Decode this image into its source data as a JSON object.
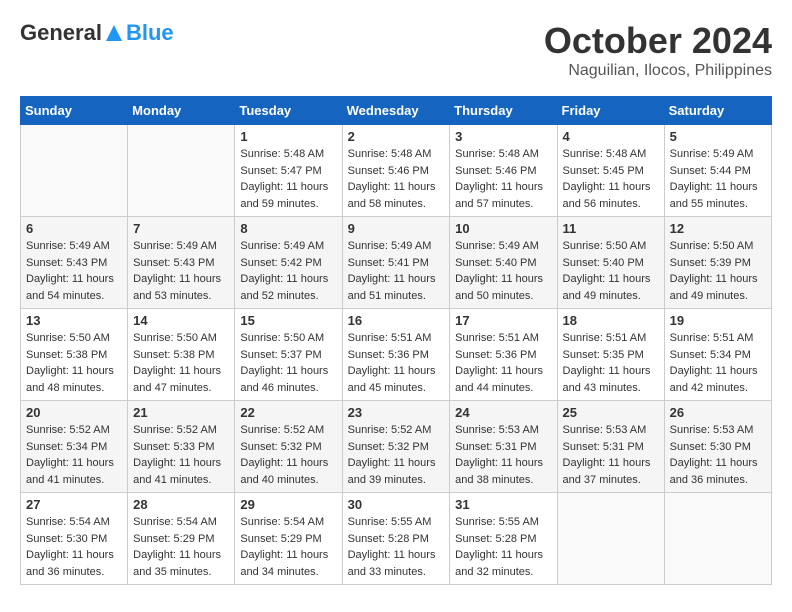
{
  "header": {
    "logo_general": "General",
    "logo_blue": "Blue",
    "month": "October 2024",
    "location": "Naguilian, Ilocos, Philippines"
  },
  "weekdays": [
    "Sunday",
    "Monday",
    "Tuesday",
    "Wednesday",
    "Thursday",
    "Friday",
    "Saturday"
  ],
  "weeks": [
    [
      {
        "day": "",
        "info": ""
      },
      {
        "day": "",
        "info": ""
      },
      {
        "day": "1",
        "info": "Sunrise: 5:48 AM\nSunset: 5:47 PM\nDaylight: 11 hours and 59 minutes."
      },
      {
        "day": "2",
        "info": "Sunrise: 5:48 AM\nSunset: 5:46 PM\nDaylight: 11 hours and 58 minutes."
      },
      {
        "day": "3",
        "info": "Sunrise: 5:48 AM\nSunset: 5:46 PM\nDaylight: 11 hours and 57 minutes."
      },
      {
        "day": "4",
        "info": "Sunrise: 5:48 AM\nSunset: 5:45 PM\nDaylight: 11 hours and 56 minutes."
      },
      {
        "day": "5",
        "info": "Sunrise: 5:49 AM\nSunset: 5:44 PM\nDaylight: 11 hours and 55 minutes."
      }
    ],
    [
      {
        "day": "6",
        "info": "Sunrise: 5:49 AM\nSunset: 5:43 PM\nDaylight: 11 hours and 54 minutes."
      },
      {
        "day": "7",
        "info": "Sunrise: 5:49 AM\nSunset: 5:43 PM\nDaylight: 11 hours and 53 minutes."
      },
      {
        "day": "8",
        "info": "Sunrise: 5:49 AM\nSunset: 5:42 PM\nDaylight: 11 hours and 52 minutes."
      },
      {
        "day": "9",
        "info": "Sunrise: 5:49 AM\nSunset: 5:41 PM\nDaylight: 11 hours and 51 minutes."
      },
      {
        "day": "10",
        "info": "Sunrise: 5:49 AM\nSunset: 5:40 PM\nDaylight: 11 hours and 50 minutes."
      },
      {
        "day": "11",
        "info": "Sunrise: 5:50 AM\nSunset: 5:40 PM\nDaylight: 11 hours and 49 minutes."
      },
      {
        "day": "12",
        "info": "Sunrise: 5:50 AM\nSunset: 5:39 PM\nDaylight: 11 hours and 49 minutes."
      }
    ],
    [
      {
        "day": "13",
        "info": "Sunrise: 5:50 AM\nSunset: 5:38 PM\nDaylight: 11 hours and 48 minutes."
      },
      {
        "day": "14",
        "info": "Sunrise: 5:50 AM\nSunset: 5:38 PM\nDaylight: 11 hours and 47 minutes."
      },
      {
        "day": "15",
        "info": "Sunrise: 5:50 AM\nSunset: 5:37 PM\nDaylight: 11 hours and 46 minutes."
      },
      {
        "day": "16",
        "info": "Sunrise: 5:51 AM\nSunset: 5:36 PM\nDaylight: 11 hours and 45 minutes."
      },
      {
        "day": "17",
        "info": "Sunrise: 5:51 AM\nSunset: 5:36 PM\nDaylight: 11 hours and 44 minutes."
      },
      {
        "day": "18",
        "info": "Sunrise: 5:51 AM\nSunset: 5:35 PM\nDaylight: 11 hours and 43 minutes."
      },
      {
        "day": "19",
        "info": "Sunrise: 5:51 AM\nSunset: 5:34 PM\nDaylight: 11 hours and 42 minutes."
      }
    ],
    [
      {
        "day": "20",
        "info": "Sunrise: 5:52 AM\nSunset: 5:34 PM\nDaylight: 11 hours and 41 minutes."
      },
      {
        "day": "21",
        "info": "Sunrise: 5:52 AM\nSunset: 5:33 PM\nDaylight: 11 hours and 41 minutes."
      },
      {
        "day": "22",
        "info": "Sunrise: 5:52 AM\nSunset: 5:32 PM\nDaylight: 11 hours and 40 minutes."
      },
      {
        "day": "23",
        "info": "Sunrise: 5:52 AM\nSunset: 5:32 PM\nDaylight: 11 hours and 39 minutes."
      },
      {
        "day": "24",
        "info": "Sunrise: 5:53 AM\nSunset: 5:31 PM\nDaylight: 11 hours and 38 minutes."
      },
      {
        "day": "25",
        "info": "Sunrise: 5:53 AM\nSunset: 5:31 PM\nDaylight: 11 hours and 37 minutes."
      },
      {
        "day": "26",
        "info": "Sunrise: 5:53 AM\nSunset: 5:30 PM\nDaylight: 11 hours and 36 minutes."
      }
    ],
    [
      {
        "day": "27",
        "info": "Sunrise: 5:54 AM\nSunset: 5:30 PM\nDaylight: 11 hours and 36 minutes."
      },
      {
        "day": "28",
        "info": "Sunrise: 5:54 AM\nSunset: 5:29 PM\nDaylight: 11 hours and 35 minutes."
      },
      {
        "day": "29",
        "info": "Sunrise: 5:54 AM\nSunset: 5:29 PM\nDaylight: 11 hours and 34 minutes."
      },
      {
        "day": "30",
        "info": "Sunrise: 5:55 AM\nSunset: 5:28 PM\nDaylight: 11 hours and 33 minutes."
      },
      {
        "day": "31",
        "info": "Sunrise: 5:55 AM\nSunset: 5:28 PM\nDaylight: 11 hours and 32 minutes."
      },
      {
        "day": "",
        "info": ""
      },
      {
        "day": "",
        "info": ""
      }
    ]
  ]
}
